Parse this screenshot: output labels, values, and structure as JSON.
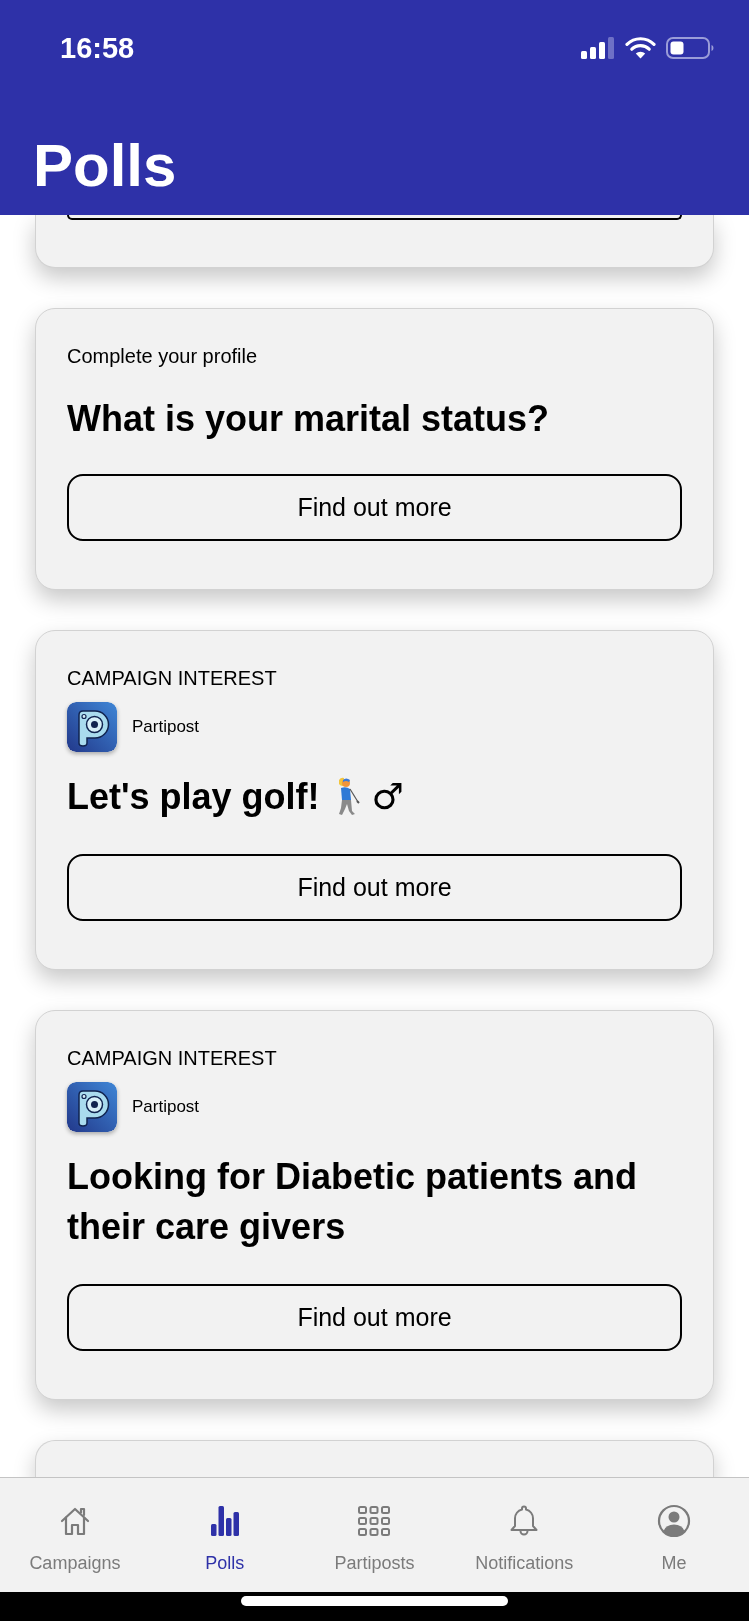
{
  "status_bar": {
    "time": "16:58"
  },
  "header": {
    "title": "Polls"
  },
  "cards": [
    {
      "kind": "cut_top"
    },
    {
      "kind": "profile",
      "label": "Complete your profile",
      "question": "What is your marital status?",
      "button": "Find out more"
    },
    {
      "kind": "campaign",
      "label": "CAMPAIGN INTEREST",
      "source": "Partipost",
      "title": "Let's play golf!",
      "title_extras": [
        {
          "kind": "emoji"
        },
        {
          "kind": "symbol",
          "text": "♂"
        }
      ],
      "button": "Find out more"
    },
    {
      "kind": "campaign",
      "label": "CAMPAIGN INTEREST",
      "source": "Partipost",
      "title": "Looking for Diabetic patients and their care givers",
      "button": "Find out more"
    },
    {
      "kind": "cut_bottom"
    }
  ],
  "nav_items": [
    {
      "label": "Campaigns",
      "selected": false
    },
    {
      "label": "Polls",
      "selected": true
    },
    {
      "label": "Partiposts",
      "selected": false
    },
    {
      "label": "Notifications",
      "selected": false
    },
    {
      "label": "Me",
      "selected": false
    }
  ]
}
